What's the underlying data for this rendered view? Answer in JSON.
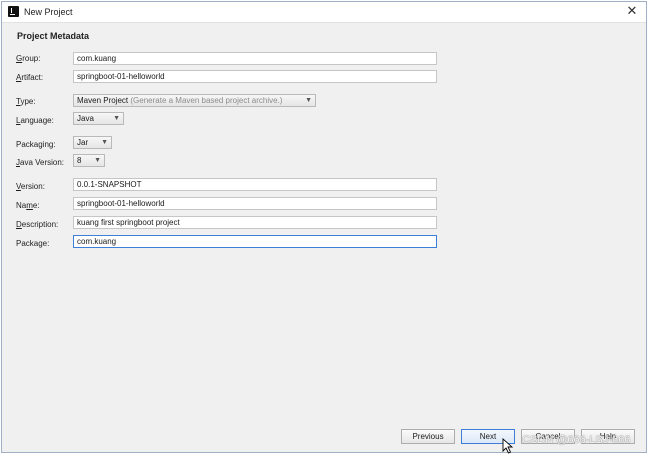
{
  "window": {
    "title": "New Project",
    "close_glyph": "✕"
  },
  "section": {
    "title": "Project Metadata"
  },
  "fields": {
    "group": {
      "label_u": "G",
      "label_rest": "roup:",
      "value": "com.kuang"
    },
    "artifact": {
      "label_u": "A",
      "label_rest": "rtifact:",
      "value": "springboot-01-helloworld"
    },
    "type": {
      "label_u": "T",
      "label_rest": "ype:",
      "value": "Maven Project",
      "hint": "(Generate a Maven based project archive.)"
    },
    "language": {
      "label_u": "L",
      "label_rest": "anguage:",
      "value": "Java"
    },
    "packaging": {
      "label_u": "",
      "label_rest": "Packaging:",
      "value": "Jar"
    },
    "java_version": {
      "label_u": "J",
      "label_rest": "ava Version:",
      "value": "8"
    },
    "version": {
      "label_u": "V",
      "label_rest": "ersion:",
      "value": "0.0.1-SNAPSHOT"
    },
    "name": {
      "label_u": "",
      "label_pre": "Na",
      "label_u2": "m",
      "label_rest": "e:",
      "value": "springboot-01-helloworld"
    },
    "description": {
      "label_u": "D",
      "label_rest": "escription:",
      "value": "kuang first springboot project"
    },
    "package": {
      "label_u": "",
      "label_rest": "Package:",
      "value": "com.kuang"
    }
  },
  "buttons": {
    "previous": "Previous",
    "next": "Next",
    "cancel": "Cancel",
    "help": "Help"
  },
  "watermark": "CSDN @666-LBJ-666",
  "icons": {
    "app": "intellij-icon",
    "close": "close-icon",
    "chevron": "chevron-down-icon"
  },
  "colors": {
    "focus": "#3d7fd6",
    "dialog_bg": "#f0f0f0"
  }
}
